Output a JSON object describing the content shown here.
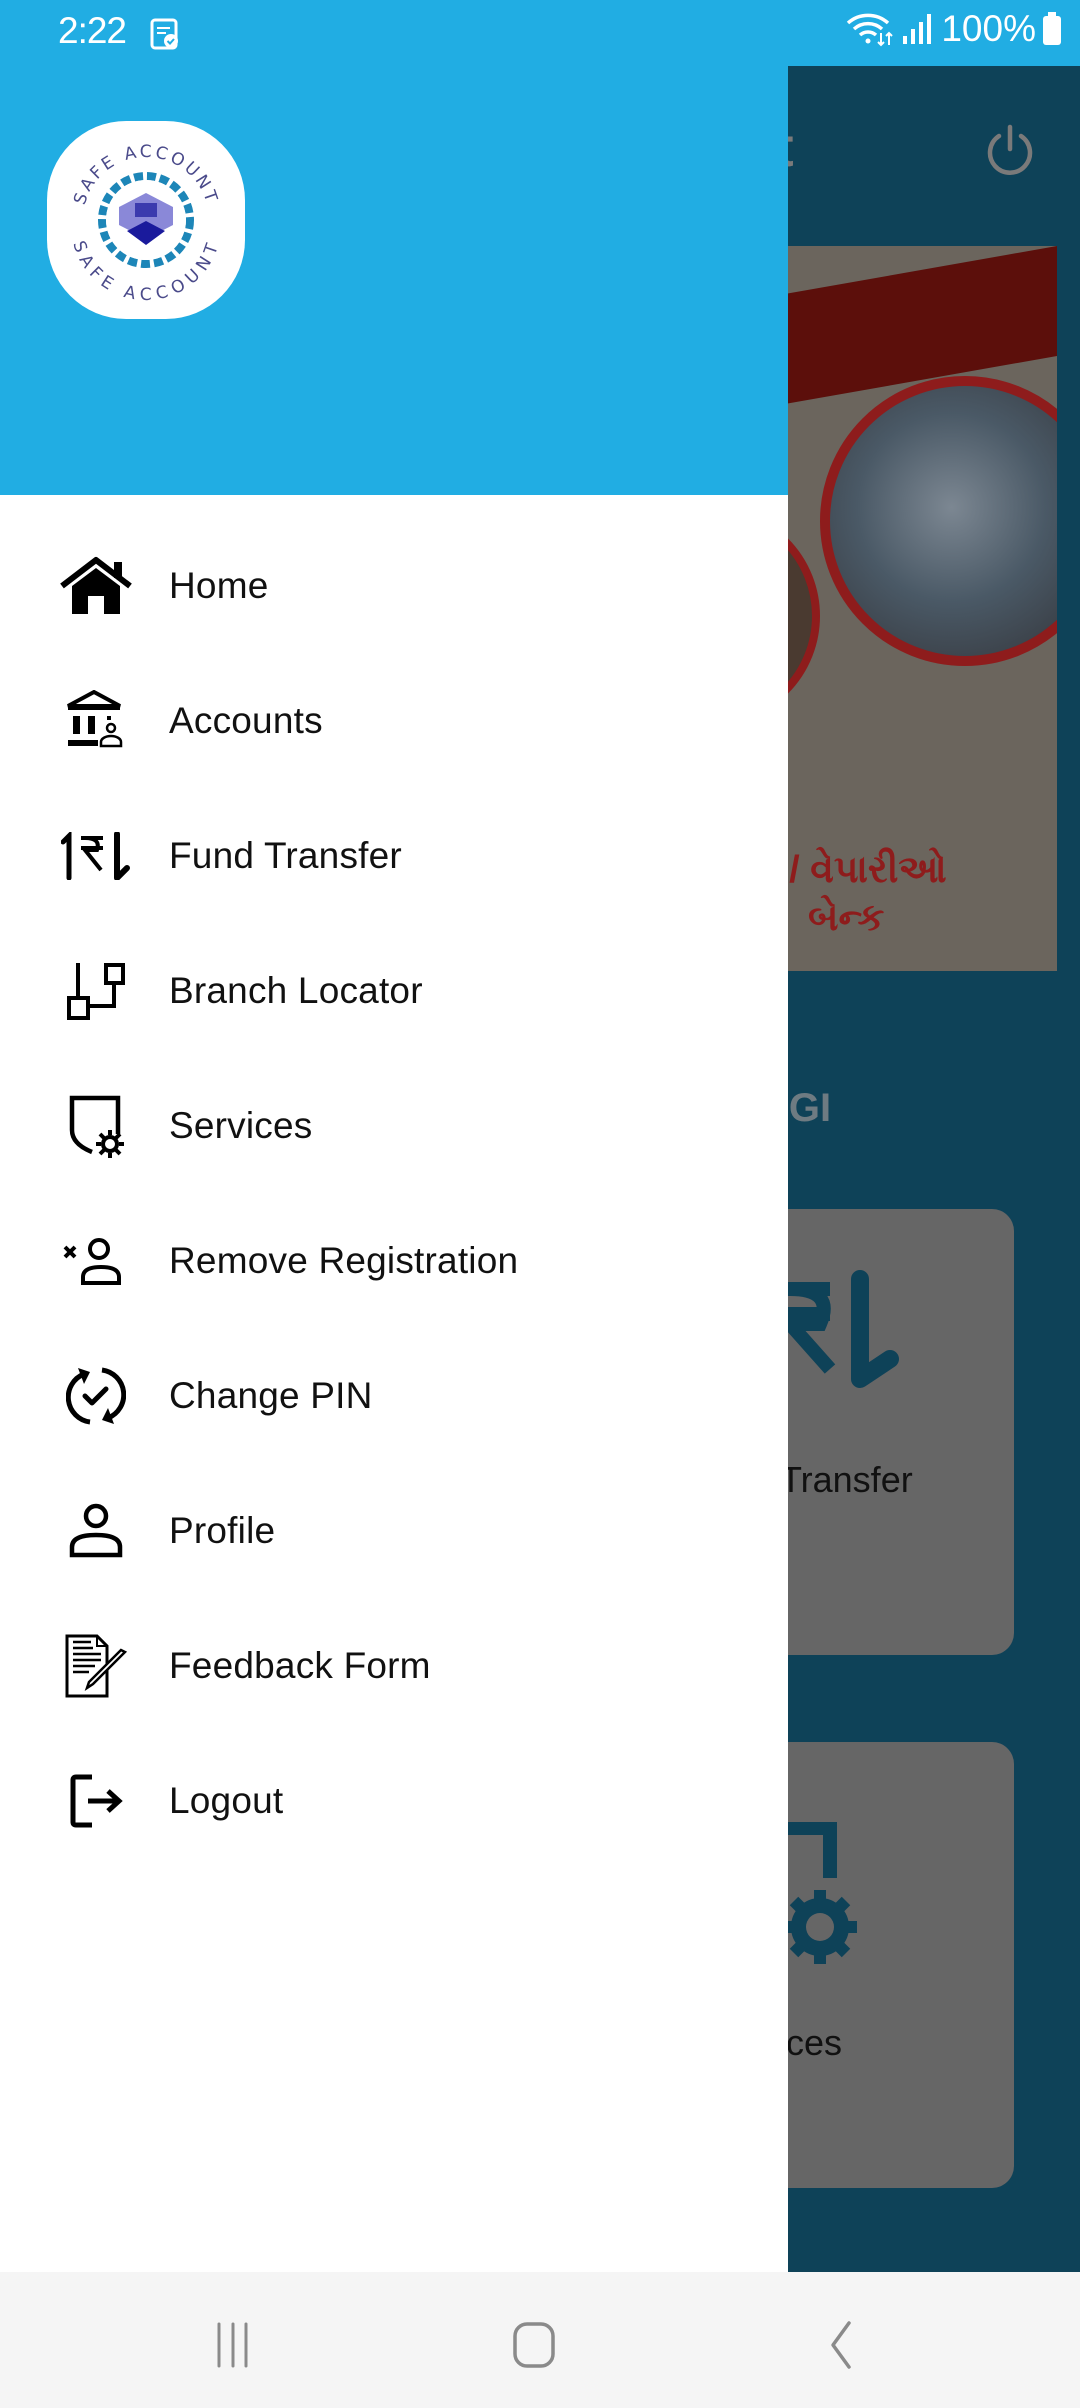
{
  "status_bar": {
    "time": "2:22",
    "battery": "100%",
    "icons": [
      "notification-note-icon",
      "wifi-icon",
      "signal-icon",
      "battery-icon"
    ]
  },
  "drawer": {
    "logo": {
      "text_top": "SAFE ACCOUNT",
      "text_bottom": "SAFE ACCOUNT"
    },
    "menu": [
      {
        "label": "Home",
        "icon": "home-icon"
      },
      {
        "label": "Accounts",
        "icon": "bank-account-icon"
      },
      {
        "label": "Fund Transfer",
        "icon": "rupee-transfer-icon"
      },
      {
        "label": "Branch Locator",
        "icon": "branch-locator-icon"
      },
      {
        "label": "Services",
        "icon": "services-icon"
      },
      {
        "label": "Remove Registration",
        "icon": "remove-user-icon"
      },
      {
        "label": "Change PIN",
        "icon": "change-pin-icon"
      },
      {
        "label": "Profile",
        "icon": "profile-icon"
      },
      {
        "label": "Feedback Form",
        "icon": "feedback-form-icon"
      },
      {
        "label": "Logout",
        "icon": "logout-icon"
      }
    ]
  },
  "background_app": {
    "title_fragment": "t",
    "banner_text_line1": "ı / વેપારીઓ",
    "banner_text_line2": "બેન્ક",
    "section_fragment": "AGI",
    "cards": [
      {
        "label_fragment": "Transfer"
      },
      {
        "label_fragment": "vices"
      }
    ]
  },
  "colors": {
    "header_blue": "#21ade3",
    "scrim_bg": "#0e4258",
    "text": "#111111",
    "nav_bg": "#f5f5f5"
  }
}
